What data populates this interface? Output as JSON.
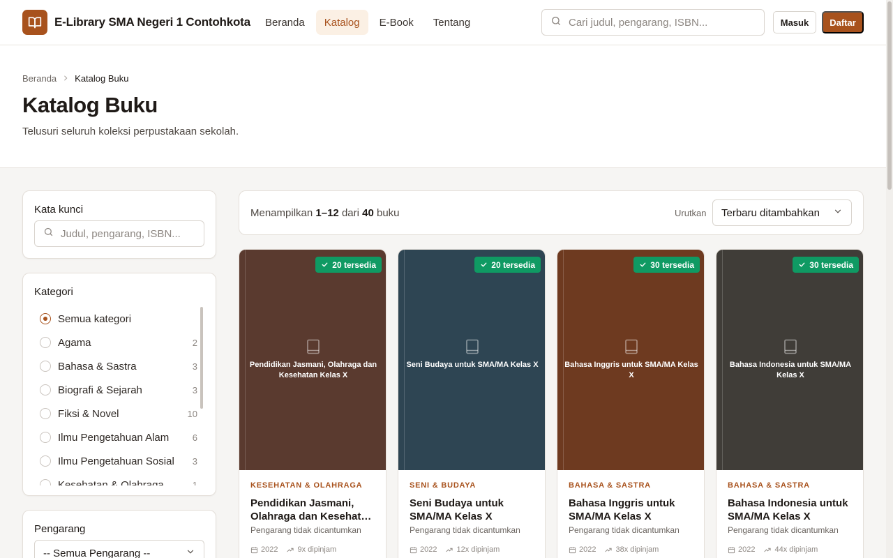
{
  "header": {
    "brand_name": "E-Library SMA Negeri 1 Contohkota",
    "nav": [
      {
        "label": "Beranda",
        "active": false
      },
      {
        "label": "Katalog",
        "active": true
      },
      {
        "label": "E-Book",
        "active": false
      },
      {
        "label": "Tentang",
        "active": false
      }
    ],
    "search_placeholder": "Cari judul, pengarang, ISBN...",
    "login_label": "Masuk",
    "register_label": "Daftar"
  },
  "hero": {
    "breadcrumb": [
      "Beranda",
      "Katalog Buku"
    ],
    "title": "Katalog Buku",
    "subtitle": "Telusuri seluruh koleksi perpustakaan sekolah."
  },
  "filters": {
    "keyword_title": "Kata kunci",
    "keyword_placeholder": "Judul, pengarang, ISBN...",
    "category_title": "Kategori",
    "categories": [
      {
        "label": "Semua kategori",
        "count": "",
        "selected": true
      },
      {
        "label": "Agama",
        "count": "2",
        "selected": false
      },
      {
        "label": "Bahasa & Sastra",
        "count": "3",
        "selected": false
      },
      {
        "label": "Biografi & Sejarah",
        "count": "3",
        "selected": false
      },
      {
        "label": "Fiksi & Novel",
        "count": "10",
        "selected": false
      },
      {
        "label": "Ilmu Pengetahuan Alam",
        "count": "6",
        "selected": false
      },
      {
        "label": "Ilmu Pengetahuan Sosial",
        "count": "3",
        "selected": false
      },
      {
        "label": "Kesehatan & Olahraga",
        "count": "1",
        "selected": false
      }
    ],
    "author_title": "Pengarang",
    "author_value": "-- Semua Pengarang --"
  },
  "results": {
    "prefix": "Menampilkan",
    "range": "1–12",
    "mid": "dari",
    "total": "40",
    "suffix": "buku",
    "sort_label": "Urutkan",
    "sort_value": "Terbaru ditambahkan"
  },
  "books": [
    {
      "available": "20 tersedia",
      "cover_color": "#5a3a2f",
      "category": "KESEHATAN & OLAHRAGA",
      "title": "Pendidikan Jasmani, Olahraga dan Kesehatan Kelas X",
      "author": "Pengarang tidak dicantumkan",
      "year": "2022",
      "borrowed": "9x dipinjam"
    },
    {
      "available": "20 tersedia",
      "cover_color": "#2e4553",
      "category": "SENI & BUDAYA",
      "title": "Seni Budaya untuk SMA/MA Kelas X",
      "author": "Pengarang tidak dicantumkan",
      "year": "2022",
      "borrowed": "12x dipinjam"
    },
    {
      "available": "30 tersedia",
      "cover_color": "#6e3a20",
      "category": "BAHASA & SASTRA",
      "title": "Bahasa Inggris untuk SMA/MA Kelas X",
      "author": "Pengarang tidak dicantumkan",
      "year": "2022",
      "borrowed": "38x dipinjam"
    },
    {
      "available": "30 tersedia",
      "cover_color": "#403d38",
      "category": "BAHASA & SASTRA",
      "title": "Bahasa Indonesia untuk SMA/MA Kelas X",
      "author": "Pengarang tidak dicantumkan",
      "year": "2022",
      "borrowed": "44x dipinjam"
    }
  ]
}
